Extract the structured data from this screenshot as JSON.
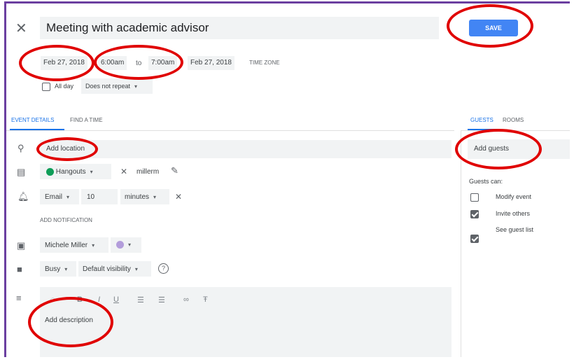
{
  "header": {
    "close_icon": "close-icon",
    "title": "Meeting with academic advisor",
    "save_label": "SAVE"
  },
  "datetime": {
    "start_date": "Feb 27, 2018",
    "start_time": "6:00am",
    "to": "to",
    "end_time": "7:00am",
    "end_date": "Feb 27, 2018",
    "timezone_label": "TIME ZONE",
    "all_day_label": "All day",
    "all_day_checked": false,
    "repeat": "Does not repeat"
  },
  "tabs": {
    "event_details": "EVENT DETAILS",
    "find_a_time": "FIND A TIME",
    "guests": "GUESTS",
    "rooms": "ROOMS"
  },
  "details": {
    "location_placeholder": "Add location",
    "conference": "Hangouts",
    "conference_id": "millerm",
    "notification_type": "Email",
    "notification_amount": "10",
    "notification_unit": "minutes",
    "add_notification": "ADD NOTIFICATION",
    "calendar_owner": "Michele Miller",
    "calendar_color": "#b39ddb",
    "availability": "Busy",
    "visibility": "Default visibility",
    "description_placeholder": "Add description"
  },
  "guests": {
    "add_placeholder": "Add guests",
    "guests_can_label": "Guests can:",
    "permissions": [
      {
        "label": "Modify event",
        "checked": false
      },
      {
        "label": "Invite others",
        "checked": true
      },
      {
        "label": "See guest list",
        "checked": true
      }
    ]
  },
  "colors": {
    "accent": "#4285f4",
    "annotation": "#e00000",
    "frame": "#6b3fa0"
  }
}
